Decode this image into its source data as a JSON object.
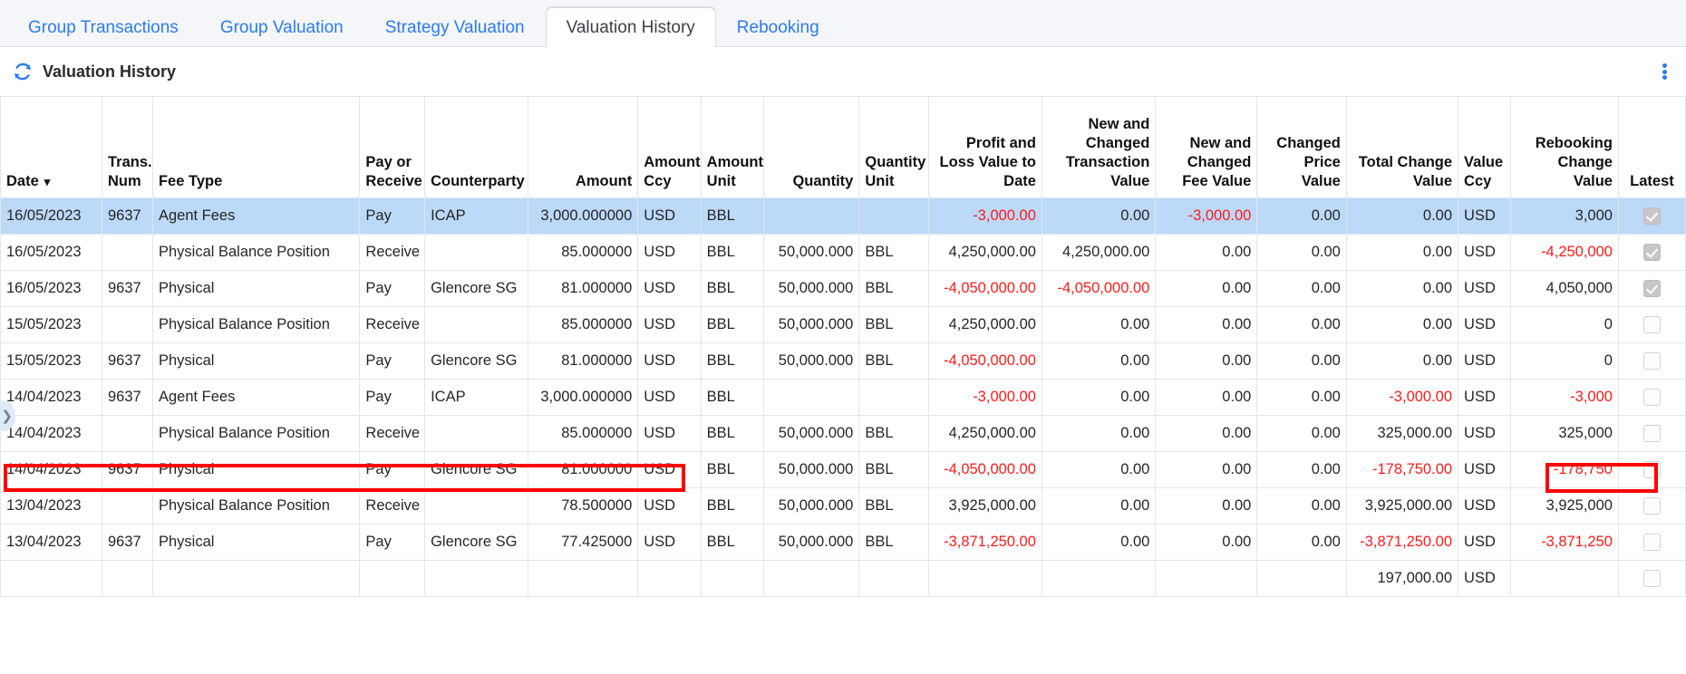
{
  "tabs": [
    {
      "label": "Group Transactions",
      "active": false
    },
    {
      "label": "Group Valuation",
      "active": false
    },
    {
      "label": "Strategy Valuation",
      "active": false
    },
    {
      "label": "Valuation History",
      "active": true
    },
    {
      "label": "Rebooking",
      "active": false
    }
  ],
  "panel": {
    "title": "Valuation History",
    "refresh_icon": "refresh-icon",
    "menu_icon": "kebab-menu-icon"
  },
  "grid": {
    "sort_column": "Date",
    "sort_indicator": "▾",
    "columns": [
      {
        "label": "Date",
        "align": "l"
      },
      {
        "label": "Trans. Num",
        "align": "l"
      },
      {
        "label": "Fee Type",
        "align": "l"
      },
      {
        "label": "Pay or Receive",
        "align": "l"
      },
      {
        "label": "Counterparty",
        "align": "l"
      },
      {
        "label": "Amount",
        "align": "r"
      },
      {
        "label": "Amount Ccy",
        "align": "l"
      },
      {
        "label": "Amount Unit",
        "align": "l"
      },
      {
        "label": "Quantity",
        "align": "r"
      },
      {
        "label": "Quantity Unit",
        "align": "l"
      },
      {
        "label": "Profit and Loss Value to Date",
        "align": "r"
      },
      {
        "label": "New and Changed Transaction Value",
        "align": "r"
      },
      {
        "label": "New and Changed Fee Value",
        "align": "r"
      },
      {
        "label": "Changed Price Value",
        "align": "r"
      },
      {
        "label": "Total Change Value",
        "align": "r"
      },
      {
        "label": "Value Ccy",
        "align": "l"
      },
      {
        "label": "Rebooking Change Value",
        "align": "r"
      },
      {
        "label": "Latest",
        "align": "c"
      }
    ],
    "rows": [
      {
        "selected": true,
        "date": "16/05/2023",
        "trans_num": "9637",
        "fee_type": "Agent Fees",
        "pay_or_receive": "Pay",
        "counterparty": "ICAP",
        "amount": "3,000.000000",
        "amount_ccy": "USD",
        "amount_unit": "BBL",
        "quantity": "",
        "quantity_unit": "",
        "pnl_to_date": "-3,000.00",
        "pnl_neg": true,
        "new_changed_txn": "0.00",
        "txn_neg": false,
        "new_changed_fee": "-3,000.00",
        "fee_neg": true,
        "changed_price": "0.00",
        "price_neg": false,
        "total_change": "0.00",
        "total_neg": false,
        "value_ccy": "USD",
        "rebooking_change": "3,000",
        "rebooking_neg": false,
        "latest": true
      },
      {
        "selected": false,
        "date": "16/05/2023",
        "trans_num": "",
        "fee_type": "Physical Balance Position",
        "pay_or_receive": "Receive",
        "counterparty": "",
        "amount": "85.000000",
        "amount_ccy": "USD",
        "amount_unit": "BBL",
        "quantity": "50,000.000",
        "quantity_unit": "BBL",
        "pnl_to_date": "4,250,000.00",
        "pnl_neg": false,
        "new_changed_txn": "4,250,000.00",
        "txn_neg": false,
        "new_changed_fee": "0.00",
        "fee_neg": false,
        "changed_price": "0.00",
        "price_neg": false,
        "total_change": "0.00",
        "total_neg": false,
        "value_ccy": "USD",
        "rebooking_change": "-4,250,000",
        "rebooking_neg": true,
        "latest": true
      },
      {
        "selected": false,
        "date": "16/05/2023",
        "trans_num": "9637",
        "fee_type": "Physical",
        "pay_or_receive": "Pay",
        "counterparty": "Glencore SG",
        "amount": "81.000000",
        "amount_ccy": "USD",
        "amount_unit": "BBL",
        "quantity": "50,000.000",
        "quantity_unit": "BBL",
        "pnl_to_date": "-4,050,000.00",
        "pnl_neg": true,
        "new_changed_txn": "-4,050,000.00",
        "txn_neg": true,
        "new_changed_fee": "0.00",
        "fee_neg": false,
        "changed_price": "0.00",
        "price_neg": false,
        "total_change": "0.00",
        "total_neg": false,
        "value_ccy": "USD",
        "rebooking_change": "4,050,000",
        "rebooking_neg": false,
        "latest": true
      },
      {
        "selected": false,
        "date": "15/05/2023",
        "trans_num": "",
        "fee_type": "Physical Balance Position",
        "pay_or_receive": "Receive",
        "counterparty": "",
        "amount": "85.000000",
        "amount_ccy": "USD",
        "amount_unit": "BBL",
        "quantity": "50,000.000",
        "quantity_unit": "BBL",
        "pnl_to_date": "4,250,000.00",
        "pnl_neg": false,
        "new_changed_txn": "0.00",
        "txn_neg": false,
        "new_changed_fee": "0.00",
        "fee_neg": false,
        "changed_price": "0.00",
        "price_neg": false,
        "total_change": "0.00",
        "total_neg": false,
        "value_ccy": "USD",
        "rebooking_change": "0",
        "rebooking_neg": false,
        "latest": false
      },
      {
        "selected": false,
        "date": "15/05/2023",
        "trans_num": "9637",
        "fee_type": "Physical",
        "pay_or_receive": "Pay",
        "counterparty": "Glencore SG",
        "amount": "81.000000",
        "amount_ccy": "USD",
        "amount_unit": "BBL",
        "quantity": "50,000.000",
        "quantity_unit": "BBL",
        "pnl_to_date": "-4,050,000.00",
        "pnl_neg": true,
        "new_changed_txn": "0.00",
        "txn_neg": false,
        "new_changed_fee": "0.00",
        "fee_neg": false,
        "changed_price": "0.00",
        "price_neg": false,
        "total_change": "0.00",
        "total_neg": false,
        "value_ccy": "USD",
        "rebooking_change": "0",
        "rebooking_neg": false,
        "latest": false
      },
      {
        "selected": false,
        "date": "14/04/2023",
        "trans_num": "9637",
        "fee_type": "Agent Fees",
        "pay_or_receive": "Pay",
        "counterparty": "ICAP",
        "amount": "3,000.000000",
        "amount_ccy": "USD",
        "amount_unit": "BBL",
        "quantity": "",
        "quantity_unit": "",
        "pnl_to_date": "-3,000.00",
        "pnl_neg": true,
        "new_changed_txn": "0.00",
        "txn_neg": false,
        "new_changed_fee": "0.00",
        "fee_neg": false,
        "changed_price": "0.00",
        "price_neg": false,
        "total_change": "-3,000.00",
        "total_neg": true,
        "value_ccy": "USD",
        "rebooking_change": "-3,000",
        "rebooking_neg": true,
        "latest": false
      },
      {
        "selected": false,
        "date": "14/04/2023",
        "trans_num": "",
        "fee_type": "Physical Balance Position",
        "pay_or_receive": "Receive",
        "counterparty": "",
        "amount": "85.000000",
        "amount_ccy": "USD",
        "amount_unit": "BBL",
        "quantity": "50,000.000",
        "quantity_unit": "BBL",
        "pnl_to_date": "4,250,000.00",
        "pnl_neg": false,
        "new_changed_txn": "0.00",
        "txn_neg": false,
        "new_changed_fee": "0.00",
        "fee_neg": false,
        "changed_price": "0.00",
        "price_neg": false,
        "total_change": "325,000.00",
        "total_neg": false,
        "value_ccy": "USD",
        "rebooking_change": "325,000",
        "rebooking_neg": false,
        "latest": false
      },
      {
        "selected": false,
        "date": "14/04/2023",
        "trans_num": "9637",
        "fee_type": "Physical",
        "pay_or_receive": "Pay",
        "counterparty": "Glencore SG",
        "amount": "81.000000",
        "amount_ccy": "USD",
        "amount_unit": "BBL",
        "quantity": "50,000.000",
        "quantity_unit": "BBL",
        "pnl_to_date": "-4,050,000.00",
        "pnl_neg": true,
        "new_changed_txn": "0.00",
        "txn_neg": false,
        "new_changed_fee": "0.00",
        "fee_neg": false,
        "changed_price": "0.00",
        "price_neg": false,
        "total_change": "-178,750.00",
        "total_neg": true,
        "value_ccy": "USD",
        "rebooking_change": "-178,750",
        "rebooking_neg": true,
        "latest": false
      },
      {
        "selected": false,
        "date": "13/04/2023",
        "trans_num": "",
        "fee_type": "Physical Balance Position",
        "pay_or_receive": "Receive",
        "counterparty": "",
        "amount": "78.500000",
        "amount_ccy": "USD",
        "amount_unit": "BBL",
        "quantity": "50,000.000",
        "quantity_unit": "BBL",
        "pnl_to_date": "3,925,000.00",
        "pnl_neg": false,
        "new_changed_txn": "0.00",
        "txn_neg": false,
        "new_changed_fee": "0.00",
        "fee_neg": false,
        "changed_price": "0.00",
        "price_neg": false,
        "total_change": "3,925,000.00",
        "total_neg": false,
        "value_ccy": "USD",
        "rebooking_change": "3,925,000",
        "rebooking_neg": false,
        "latest": false
      },
      {
        "selected": false,
        "date": "13/04/2023",
        "trans_num": "9637",
        "fee_type": "Physical",
        "pay_or_receive": "Pay",
        "counterparty": "Glencore SG",
        "amount": "77.425000",
        "amount_ccy": "USD",
        "amount_unit": "BBL",
        "quantity": "50,000.000",
        "quantity_unit": "BBL",
        "pnl_to_date": "-3,871,250.00",
        "pnl_neg": true,
        "new_changed_txn": "0.00",
        "txn_neg": false,
        "new_changed_fee": "0.00",
        "fee_neg": false,
        "changed_price": "0.00",
        "price_neg": false,
        "total_change": "-3,871,250.00",
        "total_neg": true,
        "value_ccy": "USD",
        "rebooking_change": "-3,871,250",
        "rebooking_neg": true,
        "latest": false
      }
    ],
    "footer": {
      "total_change": "197,000.00",
      "value_ccy": "USD",
      "latest": false
    }
  },
  "annotations": [
    {
      "name": "highlight-row-agent-fees-14-04-2023",
      "color": "#ff0000"
    },
    {
      "name": "highlight-cell-rebooking-change-value",
      "color": "#ff0000"
    }
  ],
  "edge_handle": {
    "icon": "chevron-right-icon",
    "glyph": "❯"
  }
}
